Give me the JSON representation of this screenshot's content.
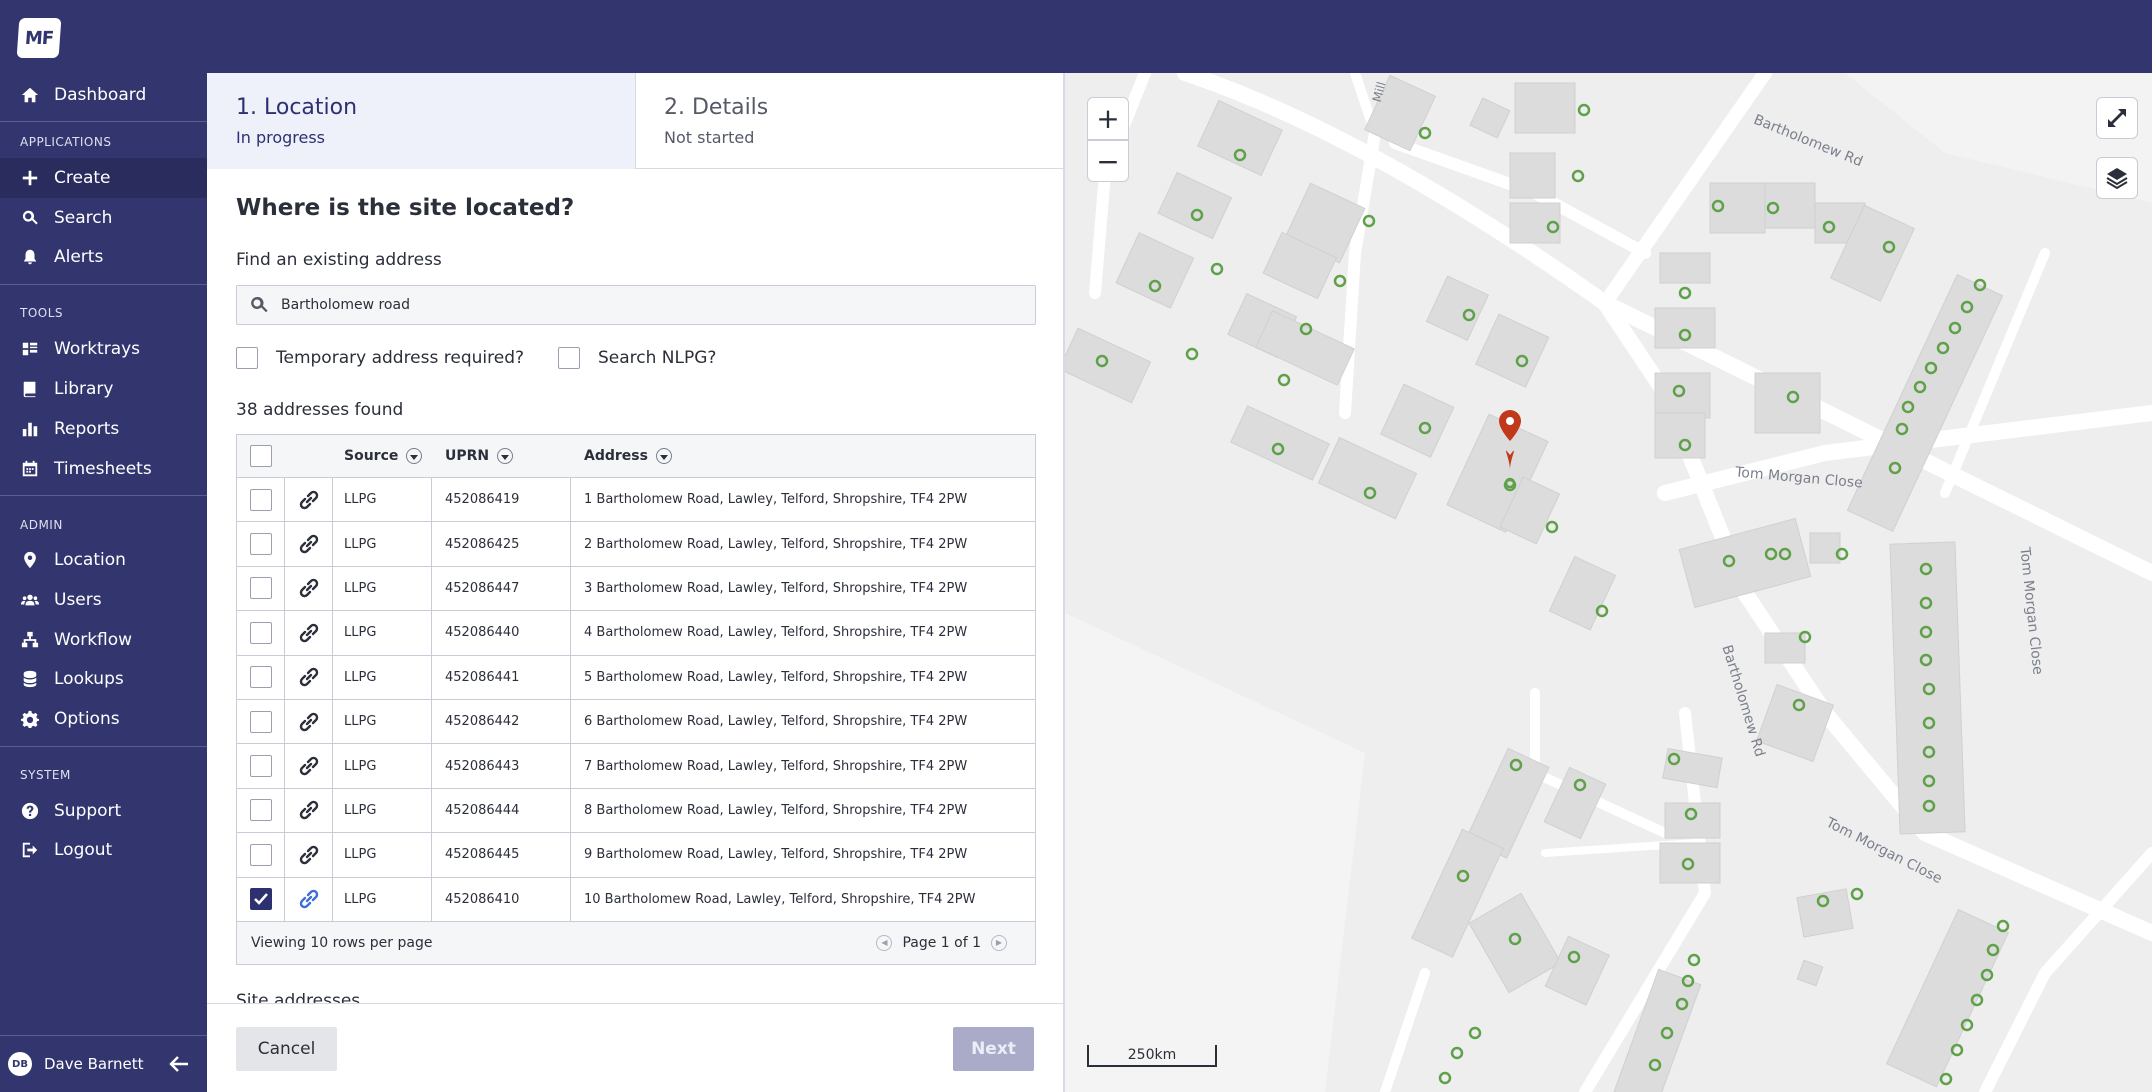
{
  "app": {
    "logo_text": "MF"
  },
  "sidebar": {
    "items": [
      {
        "label": "Dashboard",
        "icon": "home-icon"
      },
      {
        "label": "Create",
        "icon": "plus-icon",
        "active": true
      },
      {
        "label": "Search",
        "icon": "search-icon"
      },
      {
        "label": "Alerts",
        "icon": "bell-icon"
      },
      {
        "label": "Worktrays",
        "icon": "grid-icon"
      },
      {
        "label": "Library",
        "icon": "book-icon"
      },
      {
        "label": "Reports",
        "icon": "bar-chart-icon"
      },
      {
        "label": "Timesheets",
        "icon": "calendar-icon"
      },
      {
        "label": "Location",
        "icon": "location-pin-icon"
      },
      {
        "label": "Users",
        "icon": "users-icon"
      },
      {
        "label": "Workflow",
        "icon": "workflow-icon"
      },
      {
        "label": "Lookups",
        "icon": "database-icon"
      },
      {
        "label": "Options",
        "icon": "gear-icon"
      },
      {
        "label": "Support",
        "icon": "help-icon"
      },
      {
        "label": "Logout",
        "icon": "logout-icon"
      }
    ],
    "sections": {
      "applications": "APPLICATIONS",
      "tools": "TOOLS",
      "admin": "ADMIN",
      "system": "SYSTEM"
    },
    "user": {
      "initials": "DB",
      "name": "Dave Barnett"
    }
  },
  "steps": [
    {
      "title": "1. Location",
      "status": "In progress"
    },
    {
      "title": "2. Details",
      "status": "Not started"
    }
  ],
  "form": {
    "question": "Where is the site located?",
    "find_label": "Find an existing address",
    "search_value": "Bartholomew road",
    "temp_address_label": "Temporary address required?",
    "search_nlpg_label": "Search NLPG?",
    "results_count": "38 addresses found",
    "site_addresses_label": "Site addresses"
  },
  "table": {
    "columns": [
      "Source",
      "UPRN",
      "Address"
    ],
    "rows": [
      {
        "source": "LLPG",
        "uprn": "452086419",
        "address": "1 Bartholomew Road, Lawley, Telford, Shropshire, TF4 2PW",
        "checked": false
      },
      {
        "source": "LLPG",
        "uprn": "452086425",
        "address": "2 Bartholomew Road, Lawley, Telford, Shropshire, TF4 2PW",
        "checked": false
      },
      {
        "source": "LLPG",
        "uprn": "452086447",
        "address": "3 Bartholomew Road, Lawley, Telford, Shropshire, TF4 2PW",
        "checked": false
      },
      {
        "source": "LLPG",
        "uprn": "452086440",
        "address": "4 Bartholomew Road, Lawley, Telford, Shropshire, TF4 2PW",
        "checked": false
      },
      {
        "source": "LLPG",
        "uprn": "452086441",
        "address": "5 Bartholomew Road, Lawley, Telford, Shropshire, TF4 2PW",
        "checked": false
      },
      {
        "source": "LLPG",
        "uprn": "452086442",
        "address": "6 Bartholomew Road, Lawley, Telford, Shropshire, TF4 2PW",
        "checked": false
      },
      {
        "source": "LLPG",
        "uprn": "452086443",
        "address": "7 Bartholomew Road, Lawley, Telford, Shropshire, TF4 2PW",
        "checked": false
      },
      {
        "source": "LLPG",
        "uprn": "452086444",
        "address": "8 Bartholomew Road, Lawley, Telford, Shropshire, TF4 2PW",
        "checked": false
      },
      {
        "source": "LLPG",
        "uprn": "452086445",
        "address": "9 Bartholomew Road, Lawley, Telford, Shropshire, TF4 2PW",
        "checked": false
      },
      {
        "source": "LLPG",
        "uprn": "452086410",
        "address": "10 Bartholomew Road, Lawley, Telford, Shropshire, TF4 2PW",
        "checked": true
      }
    ],
    "footer_rows_text": "Viewing 10 rows per page",
    "page_text": "Page 1 of 1"
  },
  "buttons": {
    "cancel": "Cancel",
    "next": "Next"
  },
  "map": {
    "zoom_in": "+",
    "zoom_out": "−",
    "scale_label": "250km",
    "streets": [
      "Bartholomew Rd",
      "Tom Morgan Close",
      "Tom Morgan Close",
      "Bartholomew Rd",
      "Tom Morgan Close",
      "Mill"
    ],
    "colors": {
      "marker": "#c0391b",
      "point": "#5fa04a",
      "building": "#dcdcdc"
    }
  }
}
